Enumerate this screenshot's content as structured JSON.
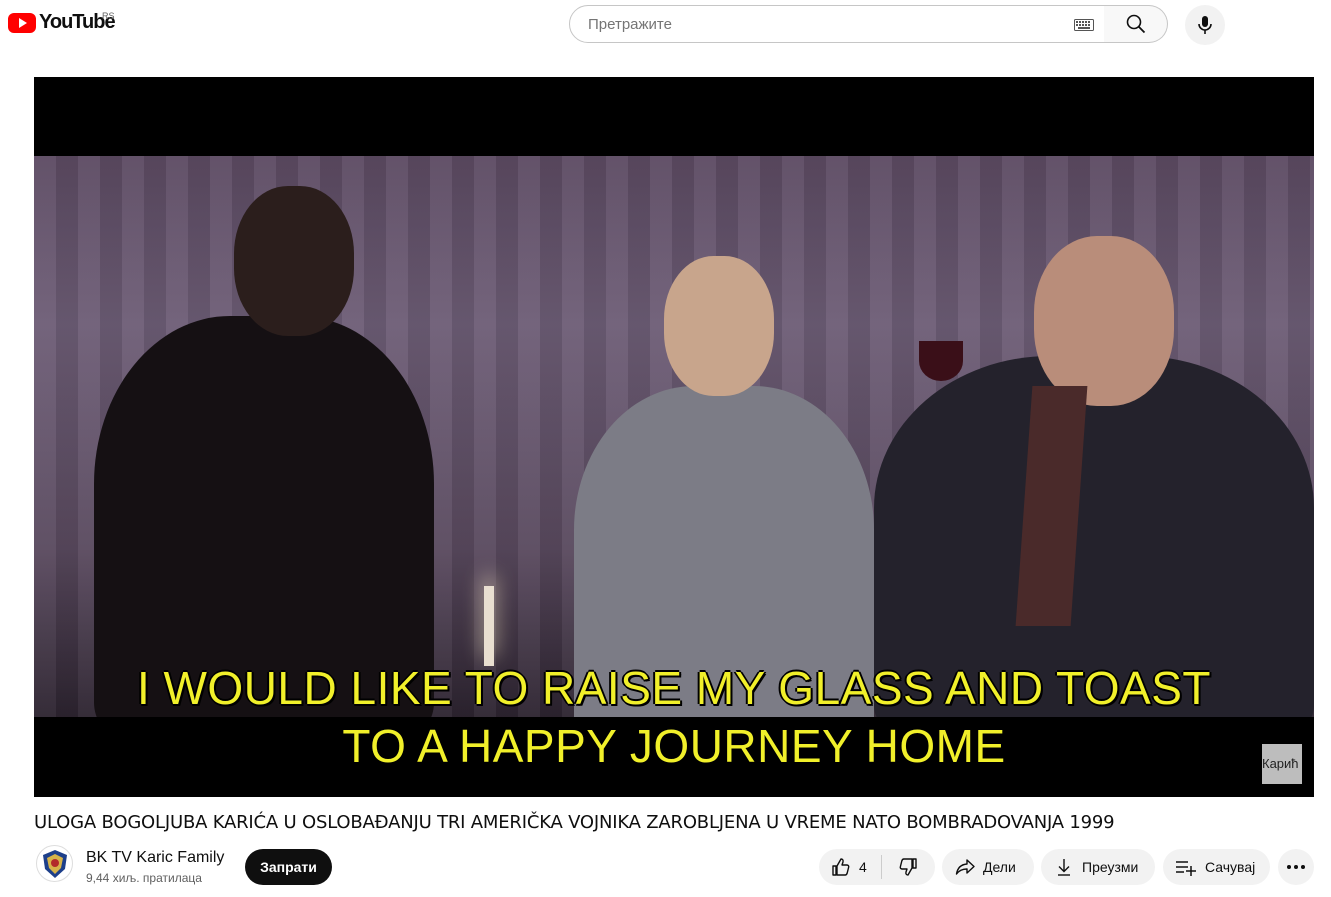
{
  "header": {
    "logo_text": "YouTube",
    "region": "RS",
    "search_placeholder": "Претражите"
  },
  "video": {
    "subtitle_line1": "I WOULD LIKE TO RAISE MY GLASS AND TOAST",
    "subtitle_line2": "TO A HAPPY JOURNEY HOME",
    "corner_tag": "Карић"
  },
  "title": "ULOGA BOGOLJUBA KARIĆA U OSLOBAĐANJU TRI AMERIČKA VOJNIKA ZAROBLJENA U VREME NATO BOMBRADOVANJA 1999",
  "channel": {
    "name": "BK TV Karic Family",
    "subscribers": "9,44 хиљ. пратилаца",
    "subscribe_label": "Запрати"
  },
  "actions": {
    "like_count": "4",
    "share_label": "Дели",
    "download_label": "Преузми",
    "save_label": "Сачувај"
  },
  "colors": {
    "brand_red": "#ff0000",
    "subtitle_yellow": "#f1f02a"
  }
}
